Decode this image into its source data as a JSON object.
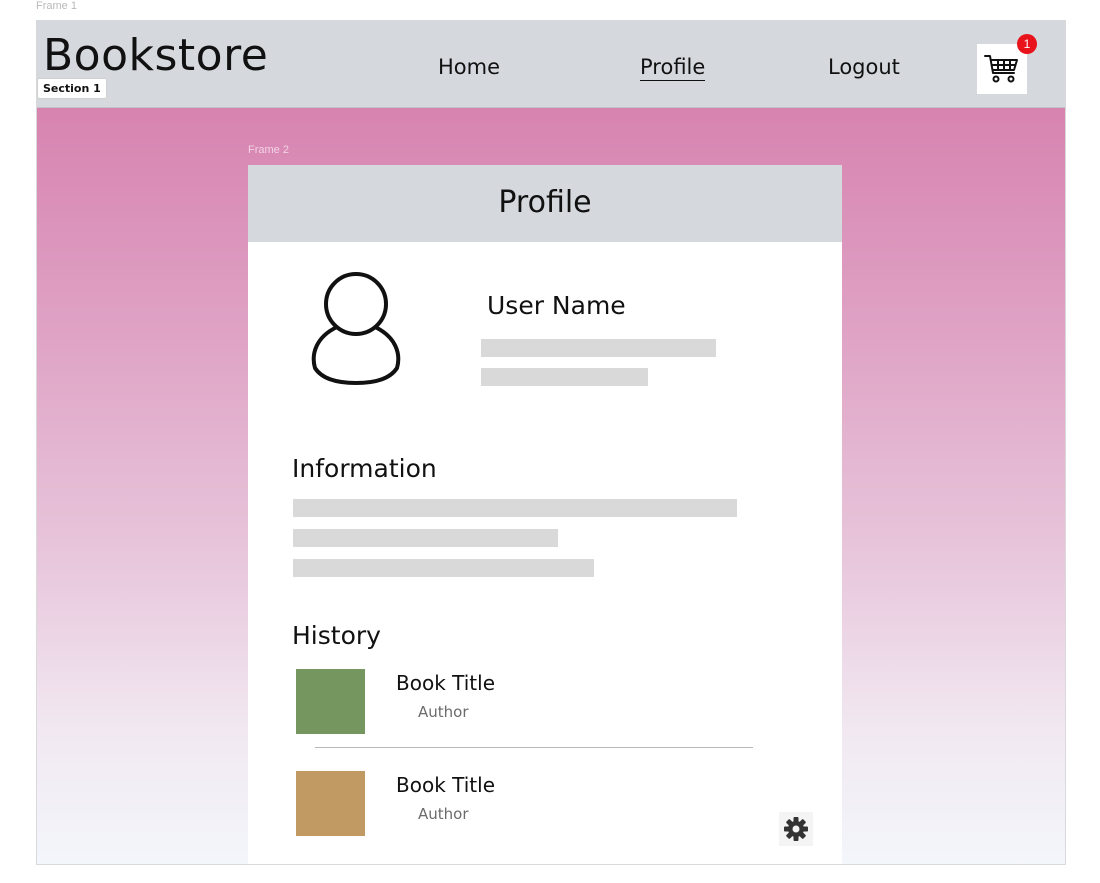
{
  "frame_label": "Frame 1",
  "navbar": {
    "brand": "Bookstore",
    "section_badge": "Section 1",
    "links": [
      {
        "label": "Home"
      },
      {
        "label": "Profile"
      },
      {
        "label": "Logout"
      }
    ],
    "cart": {
      "icon": "shopping-cart-icon",
      "count": "1"
    }
  },
  "frame2_label": "Frame 2",
  "profile": {
    "title": "Profile",
    "avatar_icon": "user-avatar-icon",
    "username": "User Name",
    "information_title": "Information",
    "history_title": "History",
    "history": [
      {
        "title": "Book Title",
        "author": "Author",
        "cover_color": "#76965f"
      },
      {
        "title": "Book Title",
        "author": "Author",
        "cover_color": "#c09a62"
      }
    ],
    "settings_icon": "gear-icon"
  },
  "colors": {
    "nav_bg": "#d5d9de",
    "badge_red": "#e8131b",
    "gradient_top": "#d783b0",
    "gradient_bottom": "#f3f6fb",
    "placeholder_bar": "#d9d9d9"
  }
}
